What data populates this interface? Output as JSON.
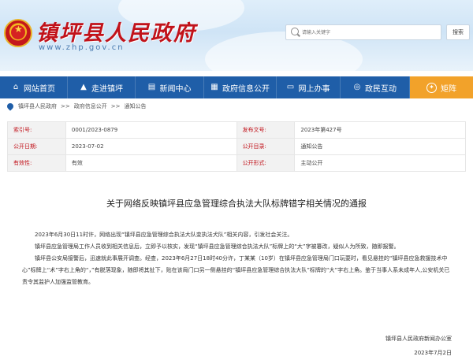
{
  "header": {
    "site_title": "镇坪县人民政府",
    "site_url": "www.zhp.gov.cn",
    "search_placeholder": "请输入关键字",
    "search_button": "搜索"
  },
  "nav": {
    "items": [
      {
        "label": "网站首页",
        "icon": "home-icon"
      },
      {
        "label": "走进镇坪",
        "icon": "mountain-icon"
      },
      {
        "label": "新闻中心",
        "icon": "news-icon"
      },
      {
        "label": "政府信息公开",
        "icon": "document-icon"
      },
      {
        "label": "网上办事",
        "icon": "computer-icon"
      },
      {
        "label": "政民互动",
        "icon": "chat-icon"
      },
      {
        "label": "矩阵",
        "icon": "matrix-icon"
      }
    ]
  },
  "breadcrumb": {
    "items": [
      "镇坪县人民政府",
      ">>",
      "政府信息公开",
      ">>",
      "通知公告"
    ]
  },
  "meta": {
    "index_label": "索引号:",
    "index_value": "0001/2023-0879",
    "doc_no_label": "发布文号:",
    "doc_no_value": "2023年第427号",
    "date_label": "公开日期:",
    "date_value": "2023-07-02",
    "catalog_label": "公开目录:",
    "catalog_value": "通知公告",
    "validity_label": "有效性:",
    "validity_value": "有效",
    "form_label": "公开形式:",
    "form_value": "主动公开"
  },
  "article": {
    "title": "关于网络反映镇坪县应急管理综合执法大队标牌错字相关情况的通报",
    "paragraphs": [
      "2023年6月30日11时许，网络出现“镇坪县应急管理综合执法大队变执法犬队”相关内容，引发社会关注。",
      "镇坪县应急管理局工作人员收到相关信息后，立即予以核实，发现“镇坪县应急管理综合执法大队”标牌上的“大”字被篡改，疑似人为所致，随即报警。",
      "镇坪县公安局接警后，迅速就此事展开调查。经查，2023年6月27日18时40分许，丁某某（10岁）在镇坪县应急管理局门口玩耍时，看见悬挂的“镇坪县应急救援技术中心”标牌上“术”字右上角的“，”有脱落现象，随即将其扯下，贴在该局门口另一侧悬挂的“镇坪县应急管理综合执法大队”标牌的“大”字右上角。鉴于当事人系未成年人,公安机关已责令其监护人加强监管教育。"
    ],
    "signature_org": "镇坪县人民政府新闻办公室",
    "signature_date": "2023年7月2日"
  },
  "colors": {
    "nav_bg": "#1f5ea8",
    "nav_highlight": "#f2a22a",
    "title_red": "#c1121a"
  }
}
